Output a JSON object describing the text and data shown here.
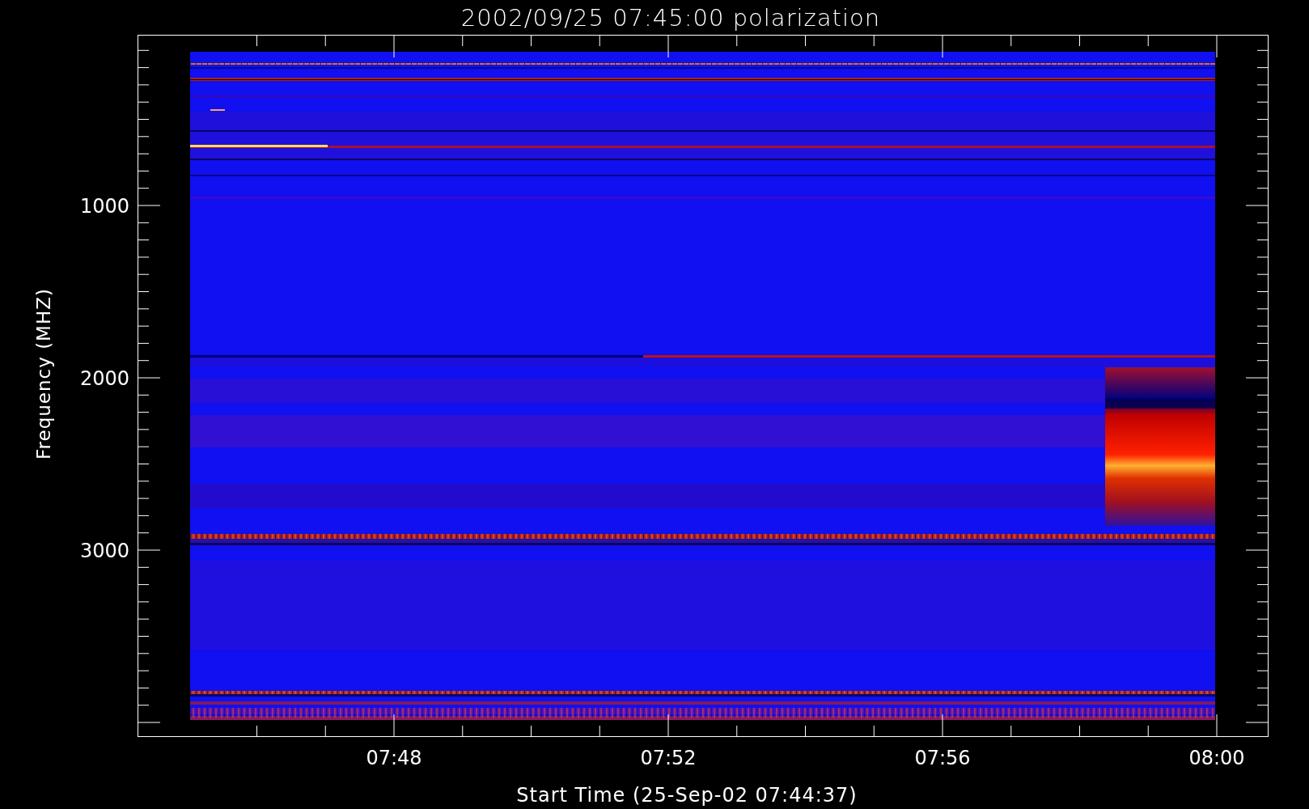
{
  "title": "2002/09/25 07:45:00 polarization",
  "y_axis": {
    "label": "Frequency (MHZ)",
    "ticks": [
      "1000",
      "2000",
      "3000"
    ]
  },
  "x_axis": {
    "label": "Start Time (25-Sep-02 07:44:37)",
    "ticks": [
      "07:48",
      "07:52",
      "07:56",
      "08:00"
    ]
  }
}
